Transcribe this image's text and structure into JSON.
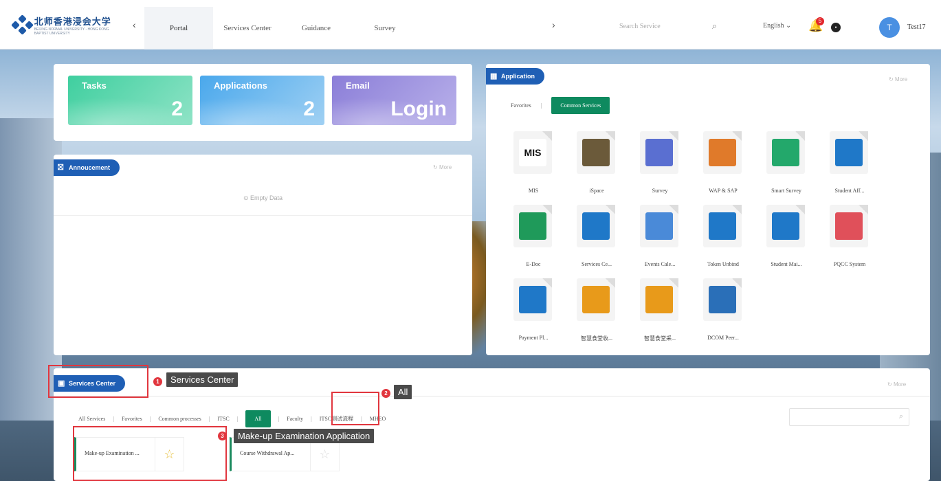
{
  "header": {
    "logo_text_cn": "北师香港浸会大学",
    "logo_text_en": "BEIJING NORMAL UNIVERSITY - HONG KONG BAPTIST UNIVERSITY",
    "tabs": [
      "Portal",
      "Services Center",
      "Guidance",
      "Survey"
    ],
    "search_placeholder": "Search Service",
    "language": "English ⌄",
    "notification_count": "5",
    "user_initial": "T",
    "user_name": "Test17"
  },
  "tiles": [
    {
      "title": "Tasks",
      "value": "2"
    },
    {
      "title": "Applications",
      "value": "2"
    },
    {
      "title": "Email",
      "value": "Login"
    }
  ],
  "announcement": {
    "title": "Annoucement",
    "more": "More",
    "empty": "Empty Data"
  },
  "application": {
    "title": "Application",
    "more": "More",
    "tab_favorites": "Favorites",
    "tab_common": "Common Services",
    "apps": [
      {
        "label": "MIS",
        "color": "#ffffff"
      },
      {
        "label": "iSpace",
        "color": "#6b5a3a"
      },
      {
        "label": "Survey",
        "color": "#5a6fd1"
      },
      {
        "label": "WAP & SAP",
        "color": "#e07a2a"
      },
      {
        "label": "Smart Survey",
        "color": "#23a86b"
      },
      {
        "label": "Student Aff...",
        "color": "#1f78c8"
      },
      {
        "label": "E-Doc",
        "color": "#1f9a5a"
      },
      {
        "label": "Services Ce...",
        "color": "#1f78c8"
      },
      {
        "label": "Events Cale...",
        "color": "#4a8ad8"
      },
      {
        "label": "Token Unbind",
        "color": "#1f78c8"
      },
      {
        "label": "Student Mai...",
        "color": "#1f78c8"
      },
      {
        "label": "PQCC System",
        "color": "#e0505a"
      },
      {
        "label": "Payment Pl...",
        "color": "#1f78c8"
      },
      {
        "label": "智慧食堂收...",
        "color": "#e89a1a"
      },
      {
        "label": "智慧食堂采...",
        "color": "#e89a1a"
      },
      {
        "label": "DCOM Peer...",
        "color": "#2a6fb8"
      }
    ]
  },
  "services": {
    "title": "Services Center",
    "more": "More",
    "tabs": [
      "All Services",
      "Favorites",
      "Common processes",
      "ITSC",
      "All",
      "Faculty",
      "ITSC测试流程",
      "MHEO"
    ],
    "items": [
      "Make-up Examination ...",
      "Course Withdrawal Ap..."
    ]
  },
  "annotations": [
    {
      "num": "1",
      "label": "Services Center"
    },
    {
      "num": "2",
      "label": "All"
    },
    {
      "num": "3",
      "label": "Make-up Examination Application"
    }
  ]
}
